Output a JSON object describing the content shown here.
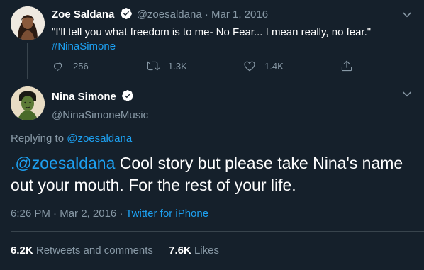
{
  "parent_tweet": {
    "name": "Zoe Saldana",
    "handle": "@zoesaldana",
    "separator": "·",
    "date": "Mar 1, 2016",
    "text": "\"I'll tell you what freedom is to me- No Fear... I mean really, no fear.\"",
    "hashtag": "#NinaSimone",
    "replies": "256",
    "retweets": "1.3K",
    "likes": "1.4K"
  },
  "main_tweet": {
    "name": "Nina Simone",
    "handle": "@NinaSimoneMusic",
    "replying_prefix": "Replying to",
    "replying_to": "@zoesaldana",
    "mention": ".@zoesaldana",
    "text": " Cool story but please take Nina's name out your mouth. For the rest of your life.",
    "time": "6:26 PM",
    "separator1": "·",
    "date": "Mar 2, 2016",
    "separator2": "·",
    "source": "Twitter for iPhone",
    "retweets_count": "6.2K",
    "retweets_label": "Retweets and comments",
    "likes_count": "7.6K",
    "likes_label": "Likes"
  },
  "icons": {
    "verified": "verified-badge-icon",
    "reply": "reply-icon",
    "retweet": "retweet-icon",
    "like": "heart-icon",
    "share": "share-icon",
    "caret": "chevron-down-icon"
  },
  "colors": {
    "background": "#15202b",
    "accent": "#1da1f2",
    "muted": "#8899a6",
    "divider": "#38444d"
  }
}
